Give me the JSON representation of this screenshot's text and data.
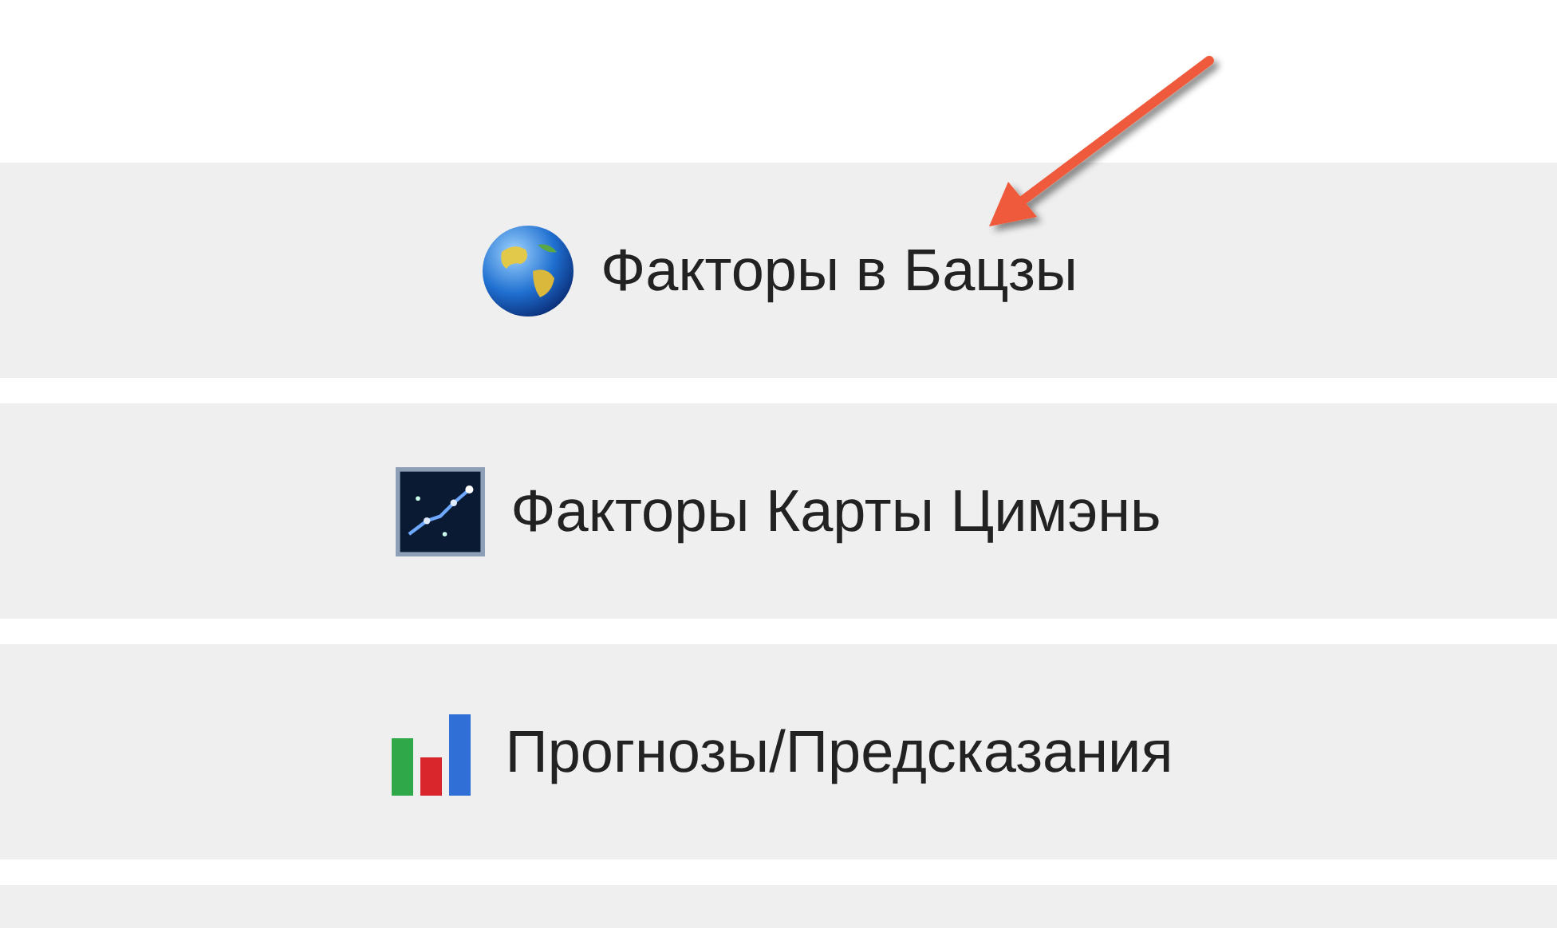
{
  "menu_items": [
    {
      "label": "Факторы в Бацзы",
      "kind": "globe"
    },
    {
      "label": "Факторы Карты Цимэнь",
      "kind": "sky"
    },
    {
      "label": "Прогнозы/Предсказания",
      "kind": "chart"
    }
  ]
}
